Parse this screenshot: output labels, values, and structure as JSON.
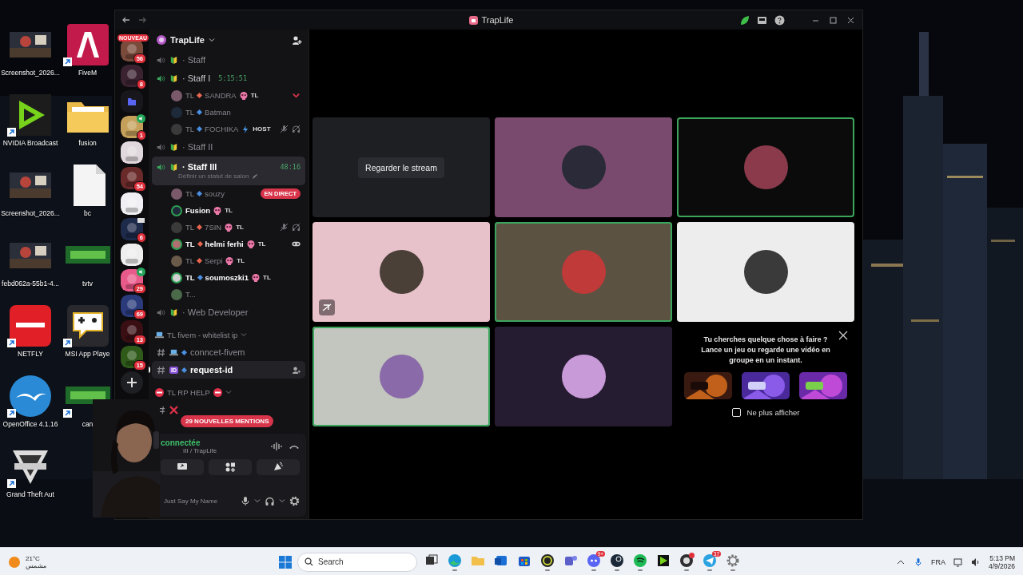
{
  "desktop_icons": [
    {
      "label": "Screenshot_2026...",
      "shortcut": false
    },
    {
      "label": "FiveM",
      "kind": "fivem",
      "shortcut": true
    },
    {
      "label": "NVIDIA Broadcast",
      "kind": "nvidia",
      "shortcut": true
    },
    {
      "label": "fusion",
      "kind": "folder",
      "shortcut": false
    },
    {
      "label": "Screenshot_2026...",
      "shortcut": false
    },
    {
      "label": "bc",
      "kind": "file",
      "shortcut": false
    },
    {
      "label": "febd062a-55b1-4...",
      "shortcut": false
    },
    {
      "label": "tvtv",
      "kind": "banner",
      "shortcut": false
    },
    {
      "label": "NETFLY",
      "kind": "netfly",
      "shortcut": true
    },
    {
      "label": "MSI App Playe",
      "kind": "msi",
      "shortcut": true
    },
    {
      "label": "OpenOffice 4.1.16",
      "kind": "openoffice",
      "shortcut": true
    },
    {
      "label": "can",
      "kind": "banner",
      "shortcut": true
    },
    {
      "label": "Grand Theft Aut",
      "kind": "gta",
      "shortcut": true
    }
  ],
  "window": {
    "title": "TrapLife"
  },
  "servers": [
    {
      "kind": "server",
      "tag": "NOUVEAU",
      "badge": "56"
    },
    {
      "kind": "server",
      "badge": "8"
    },
    {
      "kind": "folder"
    },
    {
      "kind": "server",
      "badge": "1",
      "voice": true
    },
    {
      "kind": "server"
    },
    {
      "kind": "server",
      "badge": "54"
    },
    {
      "kind": "server"
    },
    {
      "kind": "server",
      "badge": "6",
      "screen": true
    },
    {
      "kind": "server"
    },
    {
      "kind": "server",
      "badge": "29",
      "voice": true
    },
    {
      "kind": "server",
      "badge": "69"
    },
    {
      "kind": "server",
      "badge": "13"
    },
    {
      "kind": "server",
      "badge": "15"
    },
    {
      "kind": "add"
    }
  ],
  "server": {
    "name": "TrapLife"
  },
  "channels": [
    {
      "kind": "voice",
      "name": "· Staff",
      "connected": false,
      "selected": false
    },
    {
      "kind": "voice",
      "name": "· Staff I",
      "connected": true,
      "selected": false,
      "timer": "5:15:51",
      "members": [
        {
          "prefix": "TL",
          "name": "SANDRA",
          "color": "#e8664f",
          "speaking": false,
          "tag": "TL",
          "caret": true
        },
        {
          "prefix": "TL",
          "name": "Batman",
          "color": "#4a8fe0",
          "speaking": false
        },
        {
          "prefix": "TL",
          "name": "FOCHIKA",
          "color": "#4a8fe0",
          "speaking": false,
          "host": "HOST",
          "muted": true,
          "deafened": true
        }
      ]
    },
    {
      "kind": "voice",
      "name": "· Staff II",
      "connected": false,
      "selected": false
    },
    {
      "kind": "voice",
      "name": "· Staff III",
      "connected": true,
      "selected": true,
      "timer": "48:16",
      "status": "Définir un statut de salon",
      "members": [
        {
          "prefix": "TL",
          "name": "souzy",
          "color": "#4a8fe0",
          "speaking": false,
          "live": "EN DIRECT"
        },
        {
          "name": "Fusion",
          "speaking": true,
          "tag": "TL"
        },
        {
          "prefix": "TL",
          "name": "7SIN",
          "color": "#e8664f",
          "speaking": false,
          "tag": "TL",
          "muted": true,
          "deafened": true
        },
        {
          "prefix": "TL",
          "name": "helmi ferhi",
          "color": "#e8664f",
          "speaking": true,
          "tag": "TL",
          "activity": true
        },
        {
          "prefix": "TL",
          "name": "Serpi",
          "color": "#e8664f",
          "speaking": false,
          "tag": "TL"
        },
        {
          "prefix": "TL",
          "name": "soumoszki1",
          "color": "#4a8fe0",
          "speaking": true,
          "tag": "TL"
        },
        {
          "name": "T...",
          "speaking": false
        }
      ]
    },
    {
      "kind": "voice",
      "name": "· Web Developer",
      "connected": false,
      "selected": false
    },
    {
      "kind": "category",
      "name": "TL fivem - whitelist ip"
    },
    {
      "kind": "text",
      "name": "conncet-fivem",
      "selected": false
    },
    {
      "kind": "text",
      "name": "request-id",
      "icon_text": "ID",
      "selected": true,
      "unread": true
    },
    {
      "kind": "category",
      "name": "TL RP HELP"
    },
    {
      "kind": "text",
      "selected": false
    }
  ],
  "mentions_pill": "29 NOUVELLES MENTIONS",
  "voice_panel": {
    "status": "connectée",
    "channel": "III / TrapLife"
  },
  "user_panel": {
    "name": "Just Say My Name"
  },
  "tiles": [
    {
      "kind": "stream",
      "color": "#1e1f22",
      "button": "Regarder le stream",
      "speaking": false
    },
    {
      "kind": "user",
      "color": "#7a4a6e",
      "speaking": false
    },
    {
      "kind": "user",
      "color": "#0b0b0c",
      "speaking": true
    },
    {
      "kind": "user",
      "color": "#e8c2cb",
      "speaking": false,
      "muted": true
    },
    {
      "kind": "user",
      "color": "#5c5242",
      "speaking": true
    },
    {
      "kind": "user",
      "color": "#ededed",
      "speaking": false
    },
    {
      "kind": "user",
      "color": "#c3c6bf",
      "speaking": true
    },
    {
      "kind": "user",
      "color": "#261c31",
      "speaking": false
    }
  ],
  "promo": {
    "text": "Tu cherches quelque chose à faire ? Lance un jeu ou regarde une vidéo en groupe en un instant.",
    "checkbox": {
      "label": "Ne plus afficher",
      "checked": false
    }
  },
  "taskbar": {
    "weather": {
      "temp": "21°C",
      "condition": "مشمس"
    },
    "search": {
      "placeholder": "Search"
    },
    "apps": [
      {
        "kind": "taskview",
        "running": false
      },
      {
        "kind": "edge",
        "running": true
      },
      {
        "kind": "explorer",
        "running": false
      },
      {
        "kind": "outlook",
        "running": false
      },
      {
        "kind": "store",
        "running": false
      },
      {
        "kind": "gamebar",
        "running": true
      },
      {
        "kind": "teams",
        "running": false
      },
      {
        "kind": "discord",
        "badge": "9+",
        "running": true
      },
      {
        "kind": "steam",
        "running": true
      },
      {
        "kind": "spotify",
        "running": true
      },
      {
        "kind": "nvidia",
        "running": false
      },
      {
        "kind": "obs",
        "alert": true,
        "running": true
      },
      {
        "kind": "telegram",
        "badge": "37",
        "running": true
      },
      {
        "kind": "settings",
        "running": true
      }
    ],
    "language": "FRA",
    "time": "5:13 PM",
    "date": "4/9/2026"
  }
}
